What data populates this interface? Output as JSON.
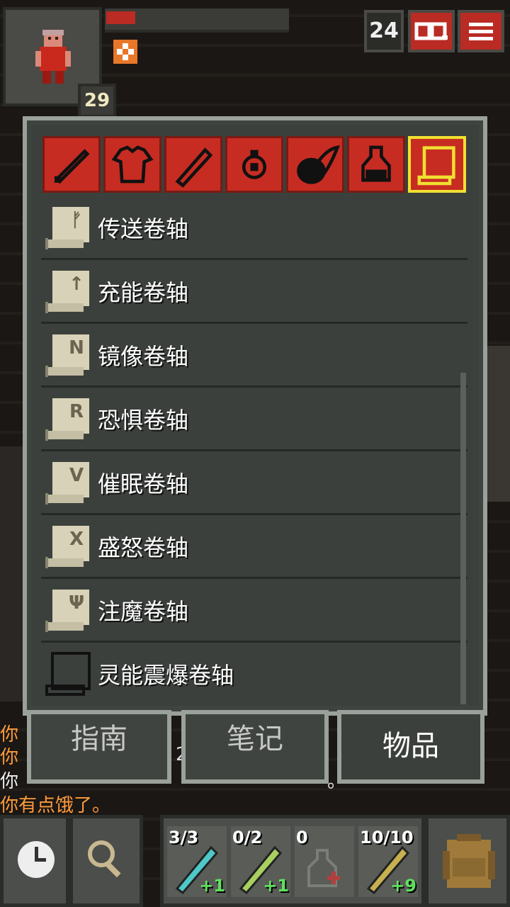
{
  "hud": {
    "level": "29",
    "depth": "24",
    "icons": [
      "hero-portrait",
      "buff-icon",
      "journal-icon",
      "menu-icon"
    ],
    "hp_fraction": 0.16
  },
  "category_tabs": [
    {
      "name": "weapon-icon",
      "selected": false
    },
    {
      "name": "armor-icon",
      "selected": false
    },
    {
      "name": "wand-icon",
      "selected": false
    },
    {
      "name": "ring-icon",
      "selected": false
    },
    {
      "name": "artifact-icon",
      "selected": false
    },
    {
      "name": "potion-icon",
      "selected": false
    },
    {
      "name": "scroll-icon",
      "selected": true
    }
  ],
  "items": [
    {
      "label": "传送卷轴",
      "rune": "ᚠ",
      "known": true
    },
    {
      "label": "充能卷轴",
      "rune": "↑",
      "known": true
    },
    {
      "label": "镜像卷轴",
      "rune": "N",
      "known": true
    },
    {
      "label": "恐惧卷轴",
      "rune": "R",
      "known": true
    },
    {
      "label": "催眠卷轴",
      "rune": "V",
      "known": true
    },
    {
      "label": "盛怒卷轴",
      "rune": "X",
      "known": true
    },
    {
      "label": "注魔卷轴",
      "rune": "Ψ",
      "known": true
    },
    {
      "label": "灵能震爆卷轴",
      "rune": "",
      "known": false
    }
  ],
  "bottom_tabs": {
    "guide": "指南",
    "notes": "笔记",
    "items": "物品"
  },
  "log": {
    "line1": "你",
    "line2": "你",
    "line3": "你",
    "line3_tail": "。",
    "line4": "你有点饿了。",
    "fragment": "2"
  },
  "quickslots": [
    {
      "count": "3/3",
      "bonus": "+1",
      "icon": "wand-icon"
    },
    {
      "count": "0/2",
      "bonus": "+1",
      "icon": "wand-icon"
    },
    {
      "count": "0",
      "bonus": "",
      "icon": "potion-icon"
    },
    {
      "count": "10/10",
      "bonus": "+9",
      "icon": "wand-icon"
    }
  ],
  "colors": {
    "accent": "#c72c22",
    "selected": "#f0e030",
    "panel": "#3f4440",
    "warn": "#ff9b3a"
  }
}
